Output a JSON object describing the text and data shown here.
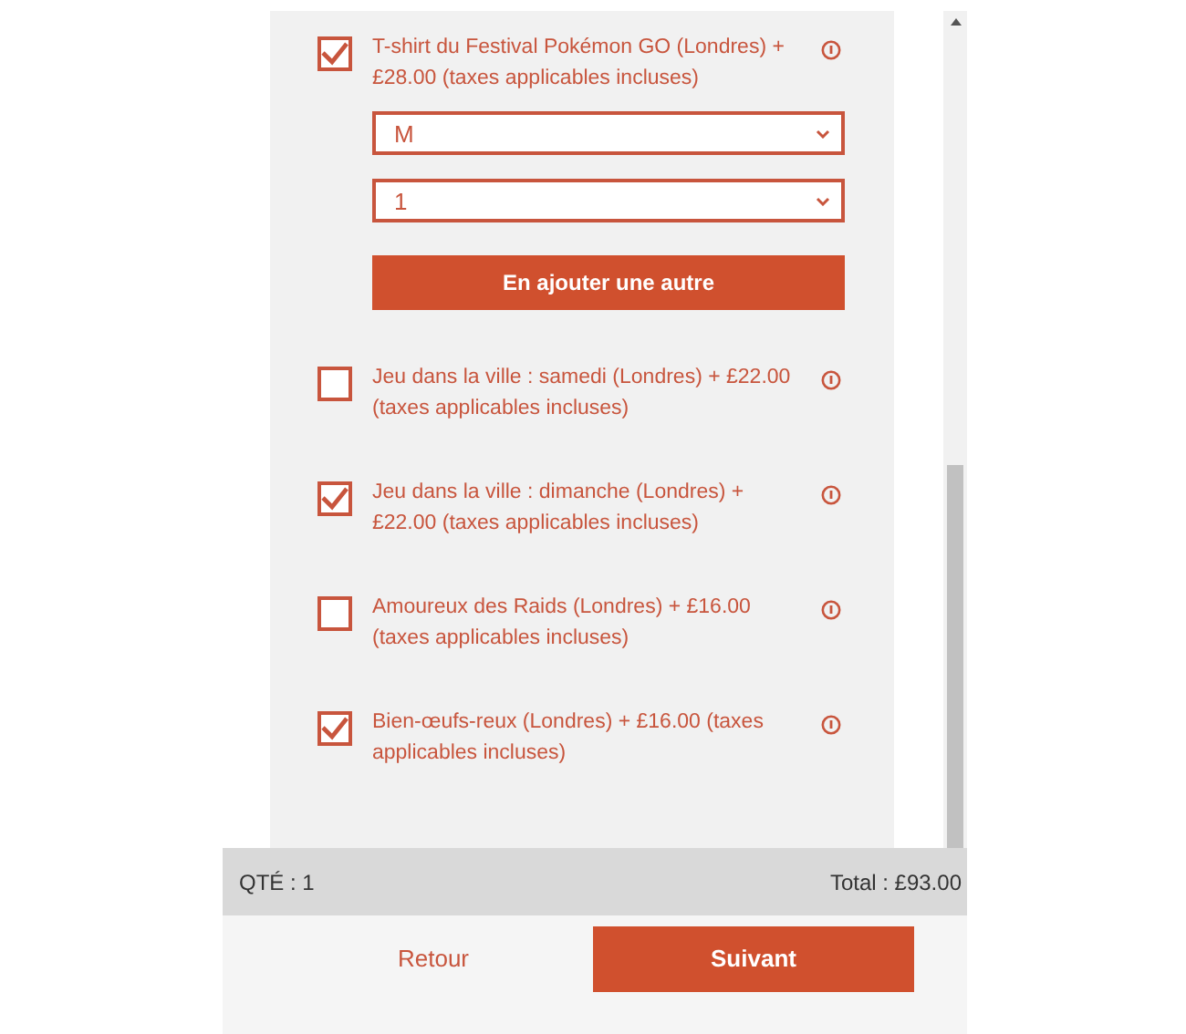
{
  "options": [
    {
      "kind": "configurable",
      "label": "T-shirt du Festival Pokémon GO (Londres) + £28.00 (taxes applicables incluses)",
      "checked": true,
      "selects": [
        "M",
        "1"
      ],
      "add_button": "En ajouter une autre"
    },
    {
      "kind": "simple",
      "label": "Jeu dans la ville : samedi (Londres) + £22.00 (taxes applicables incluses)",
      "checked": false
    },
    {
      "kind": "simple",
      "label": "Jeu dans la ville : dimanche (Londres) + £22.00 (taxes applicables incluses)",
      "checked": true
    },
    {
      "kind": "simple",
      "label": "Amoureux des Raids (Londres) + £16.00 (taxes applicables incluses)",
      "checked": false
    },
    {
      "kind": "simple",
      "label": "Bien-œufs-reux (Londres) + £16.00 (taxes applicables incluses)",
      "checked": true
    }
  ],
  "summary": {
    "quantity": "QTÉ : 1",
    "total": "Total : £93.00"
  },
  "buttons": {
    "back": "Retour",
    "next": "Suivant"
  }
}
